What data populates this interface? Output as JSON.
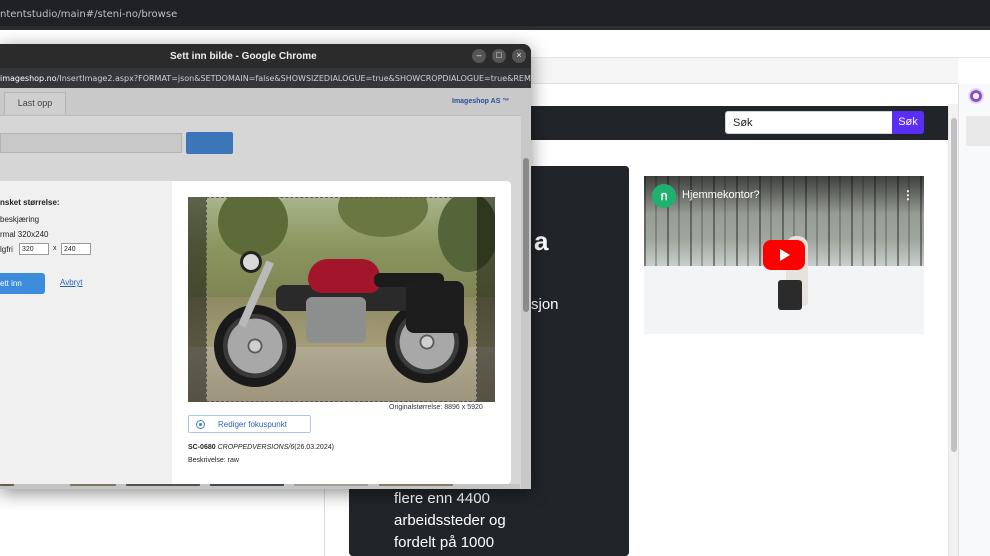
{
  "browser": {
    "url_fragment": "ntentstudio/main#/steni-no/browse"
  },
  "site": {
    "search": {
      "value": "Søk",
      "button_label": "Søk"
    },
    "card": {
      "heading_fragment": "a",
      "text_fragment": "sjon",
      "body_lines": [
        "flere enn 4400",
        "arbeidssteder og",
        "fordelt på 1000"
      ]
    },
    "video": {
      "channel_logo": "ก",
      "title": "Hjemmekontor?",
      "menu_icon": "vertical-dots-icon",
      "play_icon": "youtube-play-icon"
    }
  },
  "dialog": {
    "title": "Sett inn bilde - Google Chrome",
    "url_domain": "imageshop.no",
    "url_path": "/InsertImage2.aspx?FORMAT=json&SETDOMAIN=false&SHOWSIZEDIALOGUE=true&SHOWCROPDIALOGUE=true&REM...",
    "window_buttons": {
      "minimize": "–",
      "maximize": "□",
      "close": "×"
    },
    "toolbar": {
      "tab_last_upload": "Last opp",
      "brand_link": "Imageshop AS ™"
    },
    "modal": {
      "size_label": "nsket størrelse:",
      "option_no_crop": "beskjæring",
      "option_normal": "rmal 320x240",
      "option_custom": "lgfri",
      "width_value": "320",
      "height_value": "240",
      "times_sign": "x",
      "insert_button": "ett inn",
      "cancel_link": "Avbryt",
      "original_size": "Originalstørrelse: 8896 x 5920",
      "focus_button": "Rediger fokuspunkt",
      "image_code": "SC-0680",
      "image_version": "CROPPEDVERSIONS/6",
      "image_date": "(26.03.2024)",
      "description": "Beskrivelse: raw"
    }
  },
  "colors": {
    "accent_purple": "#5a2ef5",
    "dialog_button_blue": "#3d8bdb",
    "link_blue": "#2a62b4",
    "dark_card": "#212529"
  }
}
